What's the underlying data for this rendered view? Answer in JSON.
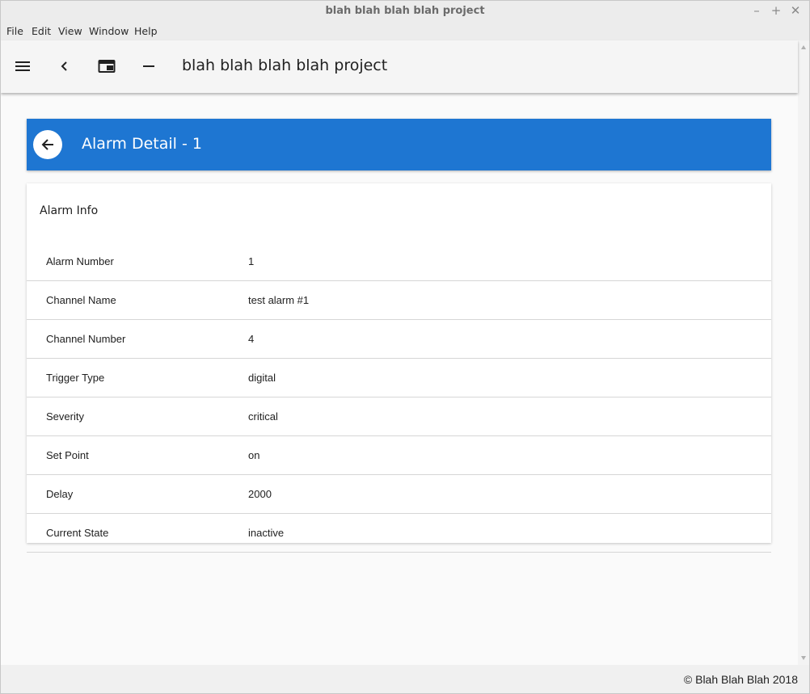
{
  "window": {
    "title": "blah blah blah blah project",
    "controls": {
      "minimize": "–",
      "maximize": "+",
      "close": "✕"
    }
  },
  "menubar": {
    "items": [
      "File",
      "Edit",
      "View",
      "Window",
      "Help"
    ]
  },
  "appbar": {
    "title": "blah blah blah blah project",
    "icons": [
      "menu-icon",
      "chevron-left-icon",
      "window-icon",
      "minus-icon"
    ]
  },
  "header": {
    "title": "Alarm Detail - 1",
    "back_icon": "arrow-left-icon"
  },
  "card": {
    "title": "Alarm Info",
    "rows": [
      {
        "label": "Alarm Number",
        "value": "1"
      },
      {
        "label": "Channel Name",
        "value": "test alarm #1"
      },
      {
        "label": "Channel Number",
        "value": "4"
      },
      {
        "label": "Trigger Type",
        "value": "digital"
      },
      {
        "label": "Severity",
        "value": "critical"
      },
      {
        "label": "Set Point",
        "value": "on"
      },
      {
        "label": "Delay",
        "value": "2000"
      },
      {
        "label": "Current State",
        "value": "inactive"
      }
    ]
  },
  "footer": {
    "copyright": "© Blah Blah Blah 2018"
  },
  "colors": {
    "accent": "#1e76d2",
    "background": "#fafafa"
  }
}
